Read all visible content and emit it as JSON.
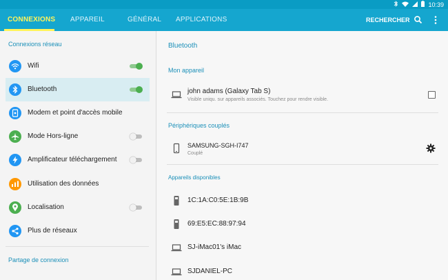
{
  "status_bar": {
    "time": "10:39"
  },
  "top_bar": {
    "tabs": [
      {
        "label": "CONNEXIONS",
        "active": true
      },
      {
        "label": "APPAREIL"
      },
      {
        "label": "GÉNÉRAL"
      },
      {
        "label": "APPLICATIONS"
      }
    ],
    "search_label": "RECHERCHER",
    "search_icon": "search-icon",
    "menu_icon": "more-vert-icon",
    "accent_color": "#fff45a",
    "bar_color": "#15a6cf"
  },
  "sidebar": {
    "section_network": "Connexions réseau",
    "section_sharing": "Partage de connexion",
    "items": [
      {
        "label": "Wifi",
        "icon": "wifi-icon",
        "icon_color": "#2196f3",
        "toggle": "on"
      },
      {
        "label": "Bluetooth",
        "icon": "bluetooth-icon",
        "icon_color": "#2196f3",
        "toggle": "on",
        "selected": true
      },
      {
        "label": "Modem et point d'accès mobile",
        "icon": "hotspot-icon",
        "icon_color": "#2196f3"
      },
      {
        "label": "Mode Hors-ligne",
        "icon": "airplane-icon",
        "icon_color": "#4caf50",
        "toggle": "off"
      },
      {
        "label": "Amplificateur téléchargement",
        "icon": "bolt-icon",
        "icon_color": "#2196f3",
        "toggle": "off"
      },
      {
        "label": "Utilisation des données",
        "icon": "data-usage-icon",
        "icon_color": "#ff9800"
      },
      {
        "label": "Localisation",
        "icon": "location-icon",
        "icon_color": "#4caf50",
        "toggle": "off"
      },
      {
        "label": "Plus de réseaux",
        "icon": "more-networks-icon",
        "icon_color": "#2196f3"
      }
    ]
  },
  "bluetooth": {
    "title": "Bluetooth",
    "my_device_header": "Mon appareil",
    "my_device": {
      "name": "john adams (Galaxy Tab S)",
      "subtitle": "Visible uniqu. sur appareils associés. Touchez pour rendre visible.",
      "icon": "laptop-icon",
      "checked": false
    },
    "paired_header": "Périphériques couplés",
    "paired": [
      {
        "name": "SAMSUNG-SGH-I747",
        "status": "Couplé",
        "icon": "phone-icon",
        "action_icon": "gear-icon"
      }
    ],
    "available_header": "Appareils disponibles",
    "available": [
      {
        "name": "1C:1A:C0:5E:1B:9B",
        "icon": "device-icon"
      },
      {
        "name": "69:E5:EC:88:97:94",
        "icon": "device-icon"
      },
      {
        "name": "SJ-iMac01's iMac",
        "icon": "laptop-icon"
      },
      {
        "name": "SJDANIEL-PC",
        "icon": "laptop-icon"
      }
    ]
  }
}
